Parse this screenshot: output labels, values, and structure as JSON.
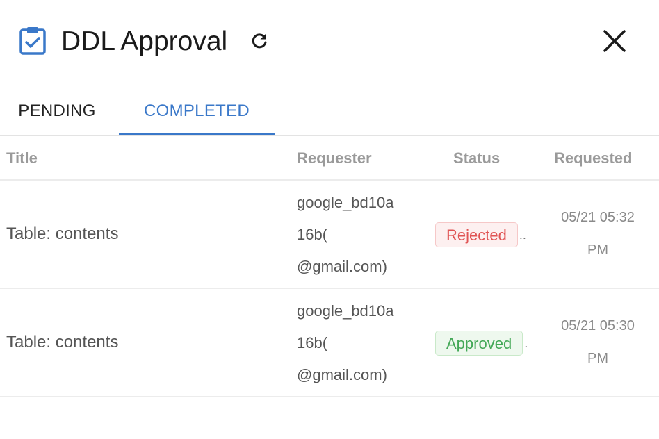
{
  "header": {
    "title": "DDL Approval",
    "icon": "clipboard-check-icon",
    "accent_color": "#3a78c9"
  },
  "tabs": [
    {
      "label": "PENDING",
      "active": false
    },
    {
      "label": "COMPLETED",
      "active": true
    }
  ],
  "table": {
    "columns": [
      "Title",
      "Requester",
      "Status",
      "Requested"
    ],
    "rows": [
      {
        "title": "Table: contents",
        "requester_lines": [
          "google_bd10a",
          "16b(",
          "@gmail.com)"
        ],
        "status": "Rejected",
        "status_trail": "..",
        "requested_lines": [
          "05/21 05:32",
          "PM"
        ]
      },
      {
        "title": "Table: contents",
        "requester_lines": [
          "google_bd10a",
          "16b(",
          "@gmail.com)"
        ],
        "status": "Approved",
        "status_trail": ".",
        "requested_lines": [
          "05/21 05:30",
          "PM"
        ]
      }
    ]
  },
  "colors": {
    "rejected": "#e05454",
    "approved": "#43a857"
  }
}
